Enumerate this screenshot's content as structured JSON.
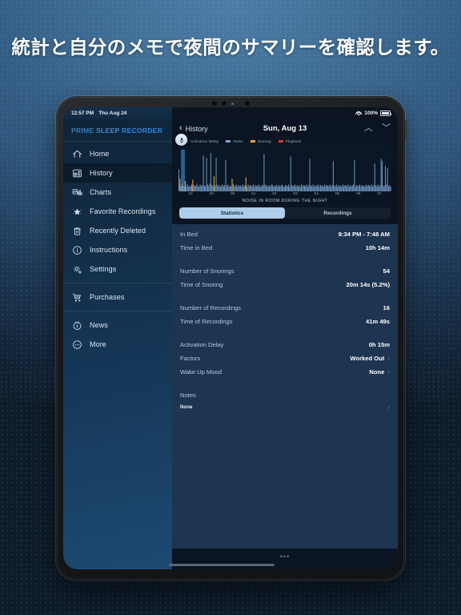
{
  "headline": "統計と自分のメモで夜間のサマリーを確認します。",
  "status_bar": {
    "time": "12:57 PM",
    "date": "Thu Aug 24",
    "battery": "100%",
    "wifi_icon": "wifi-icon",
    "battery_icon": "battery-icon"
  },
  "sidebar": {
    "brand": {
      "part1": "PRIME ",
      "part2": "SLEEP ",
      "part3": "RECORDER"
    },
    "items": [
      {
        "label": "Home",
        "icon": "home-icon",
        "active": false
      },
      {
        "label": "History",
        "icon": "history-icon",
        "active": true
      },
      {
        "label": "Charts",
        "icon": "charts-icon",
        "active": false
      },
      {
        "label": "Favorite Recordings",
        "icon": "star-icon",
        "active": false
      },
      {
        "label": "Recently Deleted",
        "icon": "trash-icon",
        "active": false
      },
      {
        "label": "Instructions",
        "icon": "info-icon",
        "active": false
      },
      {
        "label": "Settings",
        "icon": "gear-icon",
        "active": false
      }
    ],
    "group2": [
      {
        "label": "Purchases",
        "icon": "cart-icon"
      }
    ],
    "group3": [
      {
        "label": "News",
        "icon": "news-icon"
      },
      {
        "label": "More",
        "icon": "more-icon"
      }
    ]
  },
  "header": {
    "back_label": "History",
    "title": "Sun, Aug 13",
    "up_icon": "chevron-up-icon",
    "down_icon": "chevron-down-icon",
    "back_icon": "chevron-left-icon"
  },
  "chart_data": {
    "type": "bar",
    "title": "NOISE IN ROOM DURING THE NIGHT",
    "xlabel": "",
    "ylabel": "",
    "grid": false,
    "legend_position": "top-left",
    "legend": [
      {
        "name": "Activation Delay",
        "color": "#2c5f92"
      },
      {
        "name": "Noise",
        "color": "#7fa8d4"
      },
      {
        "name": "Snoring",
        "color": "#e8a33d"
      },
      {
        "name": "Playback",
        "color": "#d83a33"
      }
    ],
    "categories": [
      "22",
      "23",
      "00",
      "01",
      "02",
      "03",
      "04",
      "05",
      "06",
      "07"
    ],
    "series": [
      {
        "name": "Noise",
        "color": "#7fa8d4",
        "values": [
          38,
          12,
          9,
          14,
          10,
          8,
          11,
          9,
          13,
          8,
          10,
          9,
          12,
          8,
          11,
          9,
          10,
          13,
          8,
          9,
          12,
          9,
          11,
          62,
          10,
          9,
          58,
          12,
          9,
          14,
          66,
          11,
          9,
          13,
          10,
          58,
          12,
          9,
          11,
          8,
          10,
          12,
          9,
          11,
          54,
          9,
          12,
          8,
          10,
          9,
          11,
          13,
          9,
          10,
          12,
          8,
          11,
          9,
          10,
          8,
          12,
          9,
          11,
          10,
          8,
          12,
          9,
          11,
          10,
          9,
          12,
          8,
          11,
          9,
          10,
          12,
          8,
          9,
          11,
          10,
          64,
          12,
          9,
          11,
          8,
          10,
          9,
          12,
          11,
          8,
          10,
          9,
          12,
          8,
          11,
          9,
          10,
          12,
          9,
          8,
          11,
          10,
          9,
          12,
          8,
          60,
          11,
          9,
          10,
          12,
          8,
          11,
          9,
          10,
          8,
          12,
          9,
          11,
          10,
          9,
          12,
          8,
          11,
          56,
          10,
          9,
          12,
          8,
          11,
          9,
          10,
          12,
          8,
          11,
          9,
          10,
          8,
          12,
          9,
          11,
          10,
          9,
          12,
          8,
          11,
          52,
          10,
          9,
          12,
          8,
          11,
          9,
          10,
          8,
          12,
          9,
          11,
          10,
          9,
          12,
          8,
          11,
          9,
          10,
          12,
          54,
          8,
          11,
          9,
          10,
          12,
          8,
          11,
          9,
          10,
          8,
          12,
          9,
          11,
          10,
          9,
          12,
          8,
          11,
          48,
          10,
          9,
          12,
          8,
          11,
          56,
          52,
          9,
          10,
          44,
          12,
          40,
          9,
          11,
          8
        ]
      },
      {
        "name": "Snoring",
        "color": "#e8a33d",
        "values": [
          0,
          22,
          0,
          0,
          0,
          0,
          18,
          0,
          0,
          0,
          0,
          0,
          0,
          20,
          0,
          0,
          0,
          0,
          0,
          0,
          0,
          0,
          0,
          0,
          0,
          0,
          0,
          0,
          0,
          0,
          0,
          0,
          0,
          26,
          0,
          0,
          0,
          0,
          0,
          0,
          0,
          0,
          0,
          0,
          0,
          0,
          0,
          0,
          0,
          0,
          22,
          0,
          0,
          0,
          0,
          0,
          0,
          0,
          0,
          0,
          0,
          0,
          0,
          24,
          0,
          0,
          0,
          0,
          0,
          0,
          0,
          0,
          0,
          0,
          0,
          0,
          0,
          0,
          0,
          0,
          0,
          0,
          0,
          0,
          0,
          0,
          0,
          0,
          0,
          0,
          0,
          0,
          0,
          0,
          0,
          0,
          0,
          0,
          0,
          0,
          0,
          0,
          0,
          0,
          0,
          0,
          0,
          0,
          0,
          0,
          0,
          0,
          0,
          0,
          0,
          0,
          0,
          0,
          0,
          0,
          0,
          0,
          0,
          0,
          0,
          0,
          0,
          0,
          0,
          0,
          0,
          0,
          0,
          0,
          0,
          0,
          0,
          0,
          0,
          0,
          0,
          0,
          0,
          0,
          0,
          0,
          0,
          0,
          0,
          0,
          0,
          0,
          0,
          0,
          0,
          0,
          0,
          0,
          0,
          0,
          0,
          0,
          0,
          0,
          0,
          0,
          0,
          0,
          0,
          0,
          0,
          0,
          0,
          0,
          0,
          0,
          0,
          0,
          0,
          0,
          0,
          0,
          0,
          0,
          0,
          0,
          0,
          0,
          0,
          0,
          0,
          0,
          0,
          0,
          0,
          0,
          0,
          0,
          0,
          0
        ]
      }
    ],
    "activation_delay_bar": {
      "color": "#2c5f92",
      "x_fraction": 0.012,
      "width_fraction": 0.018,
      "height": 72
    },
    "mic_badge_icon": "microphone-icon"
  },
  "segmented": {
    "options": [
      "Statistics",
      "Recordings"
    ],
    "selected": "Statistics"
  },
  "statistics": {
    "groups": [
      [
        {
          "key": "In Bed",
          "value": "9:34 PM - 7:48 AM",
          "arrow": false
        },
        {
          "key": "Time in Bed",
          "value": "10h 14m",
          "arrow": false
        }
      ],
      [
        {
          "key": "Number of Snorings",
          "value": "54",
          "arrow": false
        },
        {
          "key": "Time of Snoring",
          "value": "20m 14s (5.2%)",
          "arrow": false
        }
      ],
      [
        {
          "key": "Number of Recordings",
          "value": "16",
          "arrow": false
        },
        {
          "key": "Time of Recordings",
          "value": "41m 49s",
          "arrow": false
        }
      ],
      [
        {
          "key": "Activation Delay",
          "value": "0h 15m",
          "arrow": false
        },
        {
          "key": "Factors",
          "value": "Worked Out",
          "arrow": true
        },
        {
          "key": "Wake Up Mood",
          "value": "None",
          "arrow": true
        }
      ]
    ],
    "notes": {
      "key": "Notes",
      "value": "None",
      "arrow": true
    }
  },
  "bottom": {
    "more_dots": "•••"
  }
}
